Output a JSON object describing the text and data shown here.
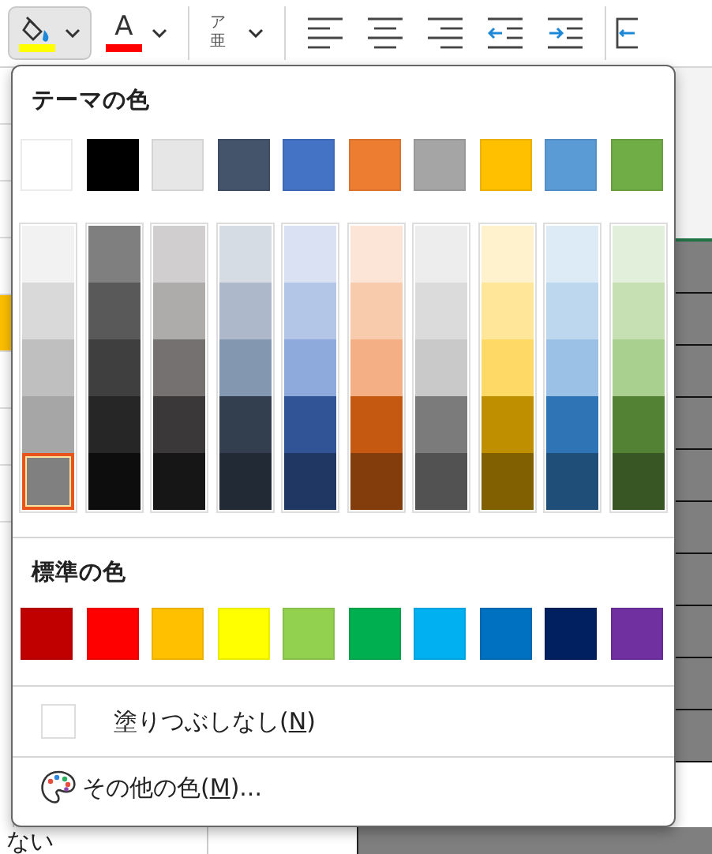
{
  "toolbar": {
    "items": [
      {
        "kind": "fill",
        "color": "#ffff00",
        "selected": true
      },
      {
        "kind": "font_color",
        "glyph": "A",
        "color": "#ff0000",
        "selected": false
      },
      {
        "kind": "phonetic",
        "top": "ア",
        "bottom": "亜",
        "selected": false
      },
      {
        "kind": "align_left"
      },
      {
        "kind": "align_center"
      },
      {
        "kind": "align_right"
      },
      {
        "kind": "outdent"
      },
      {
        "kind": "indent"
      },
      {
        "kind": "merge"
      }
    ]
  },
  "sheet": {
    "cell_text": "ない"
  },
  "panel": {
    "theme_title": "テーマの色",
    "theme_colors": [
      {
        "color": "#ffffff",
        "selected": false
      },
      {
        "color": "#000000",
        "selected": false
      },
      {
        "color": "#e7e6e6",
        "selected": false
      },
      {
        "color": "#44546a",
        "selected": false
      },
      {
        "color": "#4472c4",
        "selected": false
      },
      {
        "color": "#ed7d31",
        "selected": false
      },
      {
        "color": "#a5a5a5",
        "selected": false
      },
      {
        "color": "#ffc000",
        "selected": false
      },
      {
        "color": "#5b9bd5",
        "selected": false
      },
      {
        "color": "#70ad47",
        "selected": false
      }
    ],
    "shade_columns": [
      {
        "shades": [
          {
            "color": "#f2f2f2",
            "selected": false
          },
          {
            "color": "#d9d9d9",
            "selected": false
          },
          {
            "color": "#bfbfbf",
            "selected": false
          },
          {
            "color": "#a6a6a6",
            "selected": false
          },
          {
            "color": "#808080",
            "selected": true
          }
        ]
      },
      {
        "shades": [
          {
            "color": "#7f7f7f",
            "selected": false
          },
          {
            "color": "#595959",
            "selected": false
          },
          {
            "color": "#3f3f3f",
            "selected": false
          },
          {
            "color": "#262626",
            "selected": false
          },
          {
            "color": "#0d0d0d",
            "selected": false
          }
        ]
      },
      {
        "shades": [
          {
            "color": "#d0cece",
            "selected": false
          },
          {
            "color": "#aeabab",
            "selected": false
          },
          {
            "color": "#757171",
            "selected": false
          },
          {
            "color": "#3a3838",
            "selected": false
          },
          {
            "color": "#171616",
            "selected": false
          }
        ]
      },
      {
        "shades": [
          {
            "color": "#d6dce4",
            "selected": false
          },
          {
            "color": "#adb9ca",
            "selected": false
          },
          {
            "color": "#8497b0",
            "selected": false
          },
          {
            "color": "#333f4f",
            "selected": false
          },
          {
            "color": "#222b35",
            "selected": false
          }
        ]
      },
      {
        "shades": [
          {
            "color": "#d9e1f2",
            "selected": false
          },
          {
            "color": "#b4c6e7",
            "selected": false
          },
          {
            "color": "#8ea9db",
            "selected": false
          },
          {
            "color": "#305496",
            "selected": false
          },
          {
            "color": "#203764",
            "selected": false
          }
        ]
      },
      {
        "shades": [
          {
            "color": "#fce4d6",
            "selected": false
          },
          {
            "color": "#f8cbad",
            "selected": false
          },
          {
            "color": "#f4b084",
            "selected": false
          },
          {
            "color": "#c65911",
            "selected": false
          },
          {
            "color": "#833c0c",
            "selected": false
          }
        ]
      },
      {
        "shades": [
          {
            "color": "#ededed",
            "selected": false
          },
          {
            "color": "#dbdbdb",
            "selected": false
          },
          {
            "color": "#c9c9c9",
            "selected": false
          },
          {
            "color": "#7b7b7b",
            "selected": false
          },
          {
            "color": "#525252",
            "selected": false
          }
        ]
      },
      {
        "shades": [
          {
            "color": "#fff2cc",
            "selected": false
          },
          {
            "color": "#ffe699",
            "selected": false
          },
          {
            "color": "#ffd966",
            "selected": false
          },
          {
            "color": "#bf8f00",
            "selected": false
          },
          {
            "color": "#806000",
            "selected": false
          }
        ]
      },
      {
        "shades": [
          {
            "color": "#ddebf7",
            "selected": false
          },
          {
            "color": "#bdd7ee",
            "selected": false
          },
          {
            "color": "#9bc2e6",
            "selected": false
          },
          {
            "color": "#2f75b5",
            "selected": false
          },
          {
            "color": "#1f4e78",
            "selected": false
          }
        ]
      },
      {
        "shades": [
          {
            "color": "#e2efda",
            "selected": false
          },
          {
            "color": "#c6e0b4",
            "selected": false
          },
          {
            "color": "#a9d08e",
            "selected": false
          },
          {
            "color": "#548235",
            "selected": false
          },
          {
            "color": "#375623",
            "selected": false
          }
        ]
      }
    ],
    "standard_title": "標準の色",
    "standard_colors": [
      {
        "color": "#c00000",
        "selected": false
      },
      {
        "color": "#ff0000",
        "selected": false
      },
      {
        "color": "#ffc000",
        "selected": false
      },
      {
        "color": "#ffff00",
        "selected": false
      },
      {
        "color": "#92d050",
        "selected": false
      },
      {
        "color": "#00b050",
        "selected": false
      },
      {
        "color": "#00b0f0",
        "selected": false
      },
      {
        "color": "#0070c0",
        "selected": false
      },
      {
        "color": "#002060",
        "selected": false
      },
      {
        "color": "#7030a0",
        "selected": false
      }
    ],
    "no_fill": {
      "text_before": "塗りつぶしなし(",
      "mnemonic": "N",
      "text_after": ")"
    },
    "more_colors": {
      "text_before": "その他の色(",
      "mnemonic": "M",
      "text_after": ")..."
    }
  }
}
